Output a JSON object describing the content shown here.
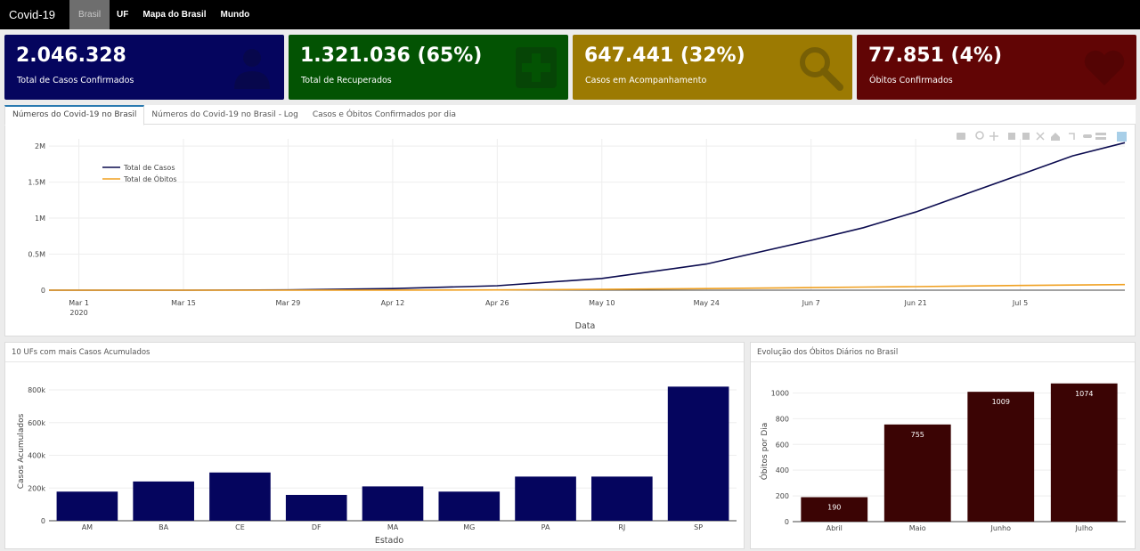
{
  "navbar": {
    "brand": "Covid-19",
    "items": [
      {
        "label": "Brasil",
        "active": true
      },
      {
        "label": "UF",
        "active": false
      },
      {
        "label": "Mapa do Brasil",
        "active": false
      },
      {
        "label": "Mundo",
        "active": false
      }
    ]
  },
  "cards": [
    {
      "value": "2.046.328",
      "label": "Total de Casos Confirmados",
      "color": "#05055e",
      "icon": "user-icon"
    },
    {
      "value": "1.321.036 (65%)",
      "label": "Total de Recuperados",
      "color": "#035303",
      "icon": "medical-cross-icon"
    },
    {
      "value": "647.441 (32%)",
      "label": "Casos em Acompanhamento",
      "color": "#9c7a02",
      "icon": "magnifier-icon"
    },
    {
      "value": "77.851 (4%)",
      "label": "Óbitos Confirmados",
      "color": "#610505",
      "icon": "heart-icon"
    }
  ],
  "tabs": [
    {
      "label": "Números do Covid-19 no Brasil",
      "active": true
    },
    {
      "label": "Números do Covid-19 no Brasil - Log",
      "active": false
    },
    {
      "label": "Casos e Óbitos Confirmados por dia",
      "active": false
    }
  ],
  "panels": {
    "top_ufs_title": "10 UFs com mais Casos Acumulados",
    "deaths_title": "Evolução dos Óbitos Diários no Brasil"
  },
  "chart_data": [
    {
      "type": "line",
      "xlabel": "Data",
      "ylabel": "",
      "x_ticks": [
        "Mar 1",
        "Mar 15",
        "Mar 29",
        "Apr 12",
        "Apr 26",
        "May 10",
        "May 24",
        "Jun 7",
        "Jun 21",
        "Jul 5"
      ],
      "x_tick_sub": {
        "Mar 1": "2020"
      },
      "y_ticks": [
        "0",
        "0.5M",
        "1M",
        "1.5M",
        "2M"
      ],
      "ylim": [
        0,
        2100000
      ],
      "x": [
        "2020-02-26",
        "2020-03-15",
        "2020-03-29",
        "2020-04-12",
        "2020-04-26",
        "2020-05-10",
        "2020-05-24",
        "2020-06-07",
        "2020-06-14",
        "2020-06-21",
        "2020-06-28",
        "2020-07-05",
        "2020-07-12",
        "2020-07-19"
      ],
      "series": [
        {
          "name": "Total de Casos",
          "color": "#0b0b4f",
          "values": [
            0,
            200,
            4300,
            22000,
            61900,
            162700,
            363200,
            691800,
            867600,
            1085000,
            1345000,
            1603000,
            1864000,
            2046328
          ]
        },
        {
          "name": "Total de Óbitos",
          "color": "#f0a020",
          "values": [
            0,
            0,
            140,
            1200,
            4200,
            11100,
            22700,
            36400,
            43300,
            49900,
            57600,
            64900,
            72100,
            77851
          ]
        }
      ],
      "legend": "top-left",
      "grid": true
    },
    {
      "type": "bar",
      "title": "10 UFs com mais Casos Acumulados",
      "xlabel": "Estado",
      "ylabel": "Casos Acumulados",
      "categories": [
        "AM",
        "BA",
        "CE",
        "DF",
        "MA",
        "MG",
        "PA",
        "RJ",
        "SP"
      ],
      "values": [
        178000,
        240000,
        295000,
        158000,
        210000,
        178000,
        270000,
        270000,
        820000
      ],
      "y_ticks": [
        "0",
        "200k",
        "400k",
        "600k",
        "800k"
      ],
      "ylim": [
        0,
        860000
      ],
      "color": "#05055e"
    },
    {
      "type": "bar",
      "title": "Evolução dos Óbitos Diários no Brasil",
      "xlabel": "",
      "ylabel": "Óbitos por Dia",
      "categories": [
        "Abril",
        "Maio",
        "Junho",
        "Julho"
      ],
      "values": [
        190,
        755,
        1009,
        1074
      ],
      "labels": [
        "190",
        "755",
        "1009",
        "1074"
      ],
      "y_ticks": [
        "0",
        "200",
        "400",
        "600",
        "800",
        "1000"
      ],
      "ylim": [
        0,
        1100
      ],
      "color": "#3b0404"
    }
  ]
}
